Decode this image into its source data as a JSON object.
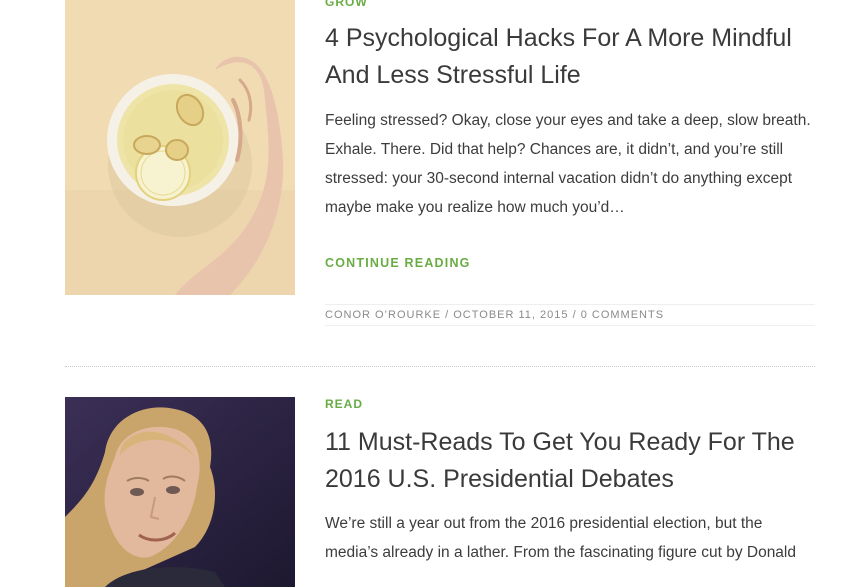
{
  "posts": [
    {
      "category": "GROW",
      "title_line1": "4 Psychological Hacks For A More Mindful",
      "title_line2": "And Less Stressful Life",
      "excerpt": [
        "Feeling stressed? Okay, close your eyes and take a deep, slow breath.",
        "Exhale. There. Did that help? Chances are, it didn’t, and you’re still",
        "stressed: your 30-second internal vacation didn’t do anything except",
        "maybe make you realize how much you’d…"
      ],
      "read_more": "CONTINUE READING",
      "author": "CONOR O’ROURKE",
      "separator": "/",
      "date": "OCTOBER 11, 2015",
      "comments_separator": "/",
      "comments": "0 COMMENTS"
    },
    {
      "category": "READ",
      "title_line1": "11 Must-Reads To Get You Ready For The",
      "title_line2": "2016 U.S. Presidential Debates",
      "excerpt": [
        "We’re still a year out from the 2016 presidential election, but the",
        "media’s already in a lather. From the fascinating figure cut by Donald"
      ]
    }
  ],
  "colors": {
    "accent": "#6aac44",
    "title": "#3a3a3a",
    "meta": "#8a8a8a"
  }
}
